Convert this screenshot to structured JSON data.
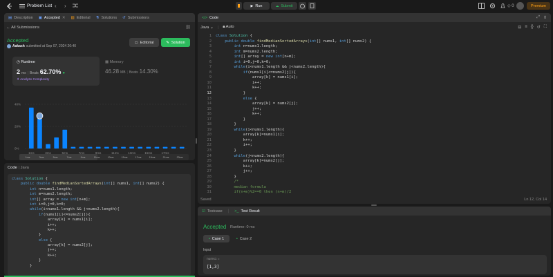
{
  "topbar": {
    "problem_list": "Problem List",
    "run": "Run",
    "submit": "Submit",
    "fire_count": "0",
    "premium": "Premium"
  },
  "left": {
    "tabs": [
      {
        "label": "Description"
      },
      {
        "label": "Accepted"
      },
      {
        "label": "Editorial"
      },
      {
        "label": "Solutions"
      },
      {
        "label": "Submissions"
      }
    ],
    "back_label": "All Submissions",
    "status": "Accepted",
    "user": "Aakash",
    "submitted_text": "submitted at Sep 07, 2024 20:40",
    "editorial_btn": "Editorial",
    "solution_btn": "Solution",
    "runtime": {
      "title": "Runtime",
      "value": "2",
      "unit": "ms",
      "beats_label": "Beats",
      "beats": "62.70%",
      "analyze": "Analyze Complexity"
    },
    "memory": {
      "title": "Memory",
      "value": "46.28",
      "unit": "MB",
      "beats_label": "Beats",
      "beats": "14.30%"
    },
    "code_header": {
      "code": "Code",
      "lang": "Java"
    }
  },
  "chart_data": {
    "type": "bar",
    "yticks": [
      "40%",
      "20%",
      "0%"
    ],
    "ylim": [
      0,
      40
    ],
    "x_labels": [
      "1ms",
      "3ms",
      "5ms",
      "7ms",
      "9ms",
      "11ms",
      "13ms",
      "15ms",
      "17ms"
    ],
    "values": [
      37,
      27,
      4,
      10,
      17,
      1.5,
      1.5,
      1.5,
      1.5,
      1.5,
      1.5,
      1.5,
      1.5,
      1.5,
      1.5,
      1.5,
      1.5,
      1.5,
      1.5
    ],
    "highlight_index": 1,
    "mini_labels": [
      "1ms",
      "3ms",
      "5ms",
      "7ms",
      "9ms",
      "11ms",
      "13ms",
      "15ms",
      "17ms",
      "19ms",
      "21ms",
      "23ms"
    ],
    "bar_color": "#0a84ff"
  },
  "editor": {
    "title": "Code",
    "lang": "Java",
    "mode": "Auto",
    "saved": "Saved",
    "cursor": "Ln 12, Col 14",
    "lines": [
      "class Solution {",
      "    public double findMedianSortedArrays(int[] nums1, int[] nums2) {",
      "        int n=nums1.length;",
      "        int m=nums2.length;",
      "        int[] array = new int[n+m];",
      "        int i=0,j=0,k=0;",
      "        while(i<nums1.length && j<nums2.length){",
      "            if(nums1[i]<=nums2[j]){",
      "                array[k] = nums1[i];",
      "                i++;",
      "                k++;",
      "            }",
      "            else {",
      "                array[k] = nums2[j];",
      "                j++;",
      "                k++;",
      "            }",
      "        }",
      "        while(i<nums1.length){",
      "            array[k]=nums1[i];",
      "            k++;",
      "            i++;",
      "        }",
      "        while(j<nums2.length){",
      "            array[k]=nums2[j];",
      "            k++;",
      "            j++;",
      "        }",
      "        /*",
      "        median formula",
      "        if(n+m)%2==0 then (n+m)/2"
    ]
  },
  "left_code": [
    "class Solution {",
    "    public double findMedianSortedArrays(int[] nums1, int[] nums2) {",
    "        int n=nums1.length;",
    "        int m=nums2.length;",
    "        int[] array = new int[n+m];",
    "        int i=0,j=0,k=0;",
    "        while(i<nums1.length && j<nums2.length){",
    "            if(nums1[i]<=nums2[j]){",
    "                array[k] = nums1[i];",
    "                i++;",
    "                k++;",
    "            }",
    "            else {",
    "                array[k] = nums2[j];",
    "                j++;",
    "                k++;",
    "            }",
    "        }"
  ],
  "testpanel": {
    "tab_testcase": "Testcase",
    "tab_result": "Test Result",
    "status": "Accepted",
    "runtime": "Runtime: 0 ms",
    "case1": "Case 1",
    "case2": "Case 2",
    "input_label": "Input",
    "var_name": "nums1 =",
    "var_value": "[1,3]"
  }
}
